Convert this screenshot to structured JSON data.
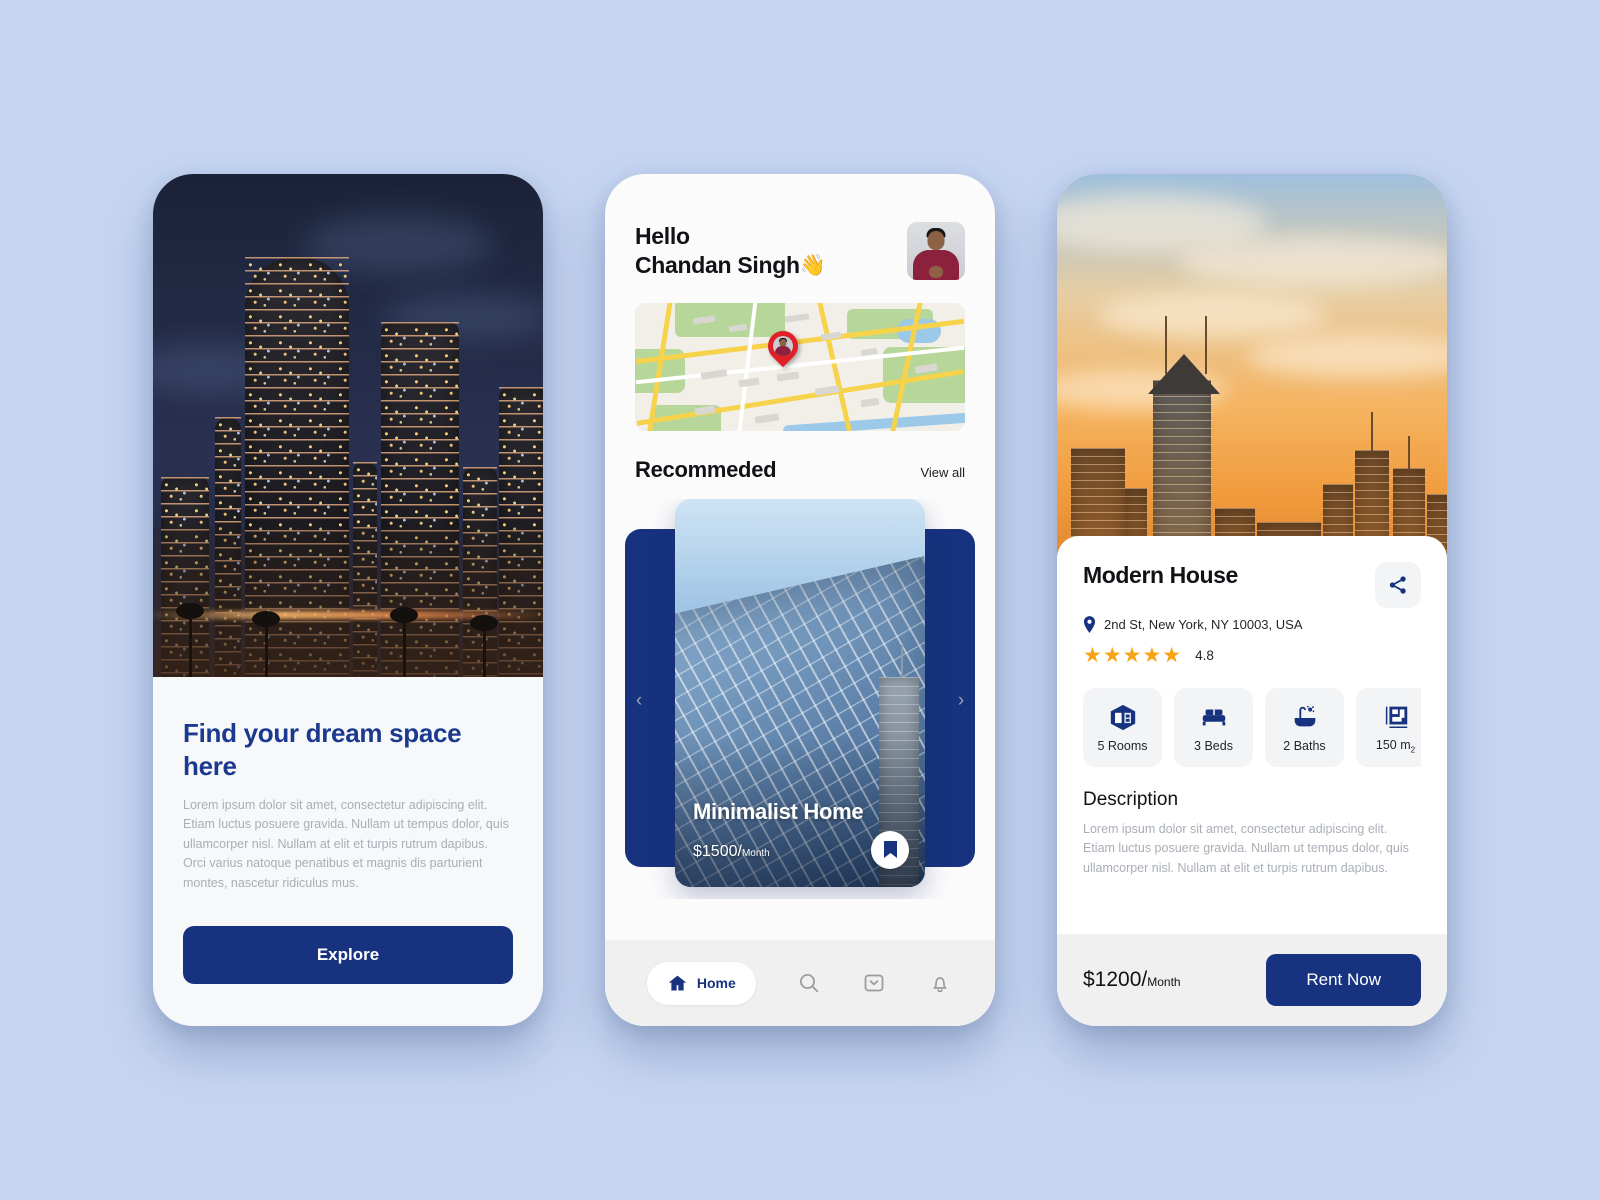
{
  "theme": {
    "background": "#c6d6f2",
    "navy": "#17337f",
    "star_orange": "#f7a313",
    "muted_text": "#a9aeb6"
  },
  "screen1": {
    "hero_image": "night-cityscape-photo",
    "title": "Find your dream space here",
    "paragraph": "Lorem ipsum dolor sit amet, consectetur adipiscing elit. Etiam luctus posuere gravida. Nullam ut tempus dolor, quis ullamcorper nisl. Nullam at elit et turpis rutrum dapibus. Orci varius natoque penatibus et magnis dis parturient montes, nascetur ridiculus mus.",
    "cta_label": "Explore"
  },
  "screen2": {
    "greeting_line1": "Hello",
    "greeting_line2": "Chandan Singh",
    "wave_emoji": "👋",
    "avatar": "user-avatar-photo",
    "map": "location-map-with-pin",
    "section_title": "Recommeded",
    "view_all_label": "View all",
    "prev_arrow": "‹",
    "next_arrow": "›",
    "card": {
      "image": "glass-skyscraper-photo",
      "name": "Minimalist Home",
      "price": "$1500/",
      "price_unit": "Month",
      "bookmark": "bookmark-icon"
    },
    "tabs": [
      {
        "label": "Home",
        "icon": "home-icon",
        "active": true
      },
      {
        "label": "",
        "icon": "search-icon",
        "active": false
      },
      {
        "label": "",
        "icon": "inbox-icon",
        "active": false
      },
      {
        "label": "",
        "icon": "bell-icon",
        "active": false
      }
    ]
  },
  "screen3": {
    "hero_image": "sunset-cityscape-photo",
    "title": "Modern House",
    "share_icon": "share-icon",
    "location_icon": "location-pin-icon",
    "address": "2nd St, New York, NY 10003, USA",
    "stars": "★★★★★",
    "rating": "4.8",
    "features": [
      {
        "icon": "room-cube-icon",
        "label": "5 Rooms"
      },
      {
        "icon": "bed-icon",
        "label": "3 Beds"
      },
      {
        "icon": "bathtub-icon",
        "label": "2 Baths"
      },
      {
        "icon": "floorplan-icon",
        "label": "150 m",
        "sub": "2"
      }
    ],
    "description_heading": "Description",
    "description_body": "Lorem ipsum dolor sit amet, consectetur adipiscing elit. Etiam luctus posuere gravida. Nullam ut tempus dolor, quis ullamcorper nisl. Nullam at elit et turpis rutrum dapibus.",
    "price": "$1200/",
    "price_unit": "Month",
    "cta_label": "Rent Now"
  }
}
